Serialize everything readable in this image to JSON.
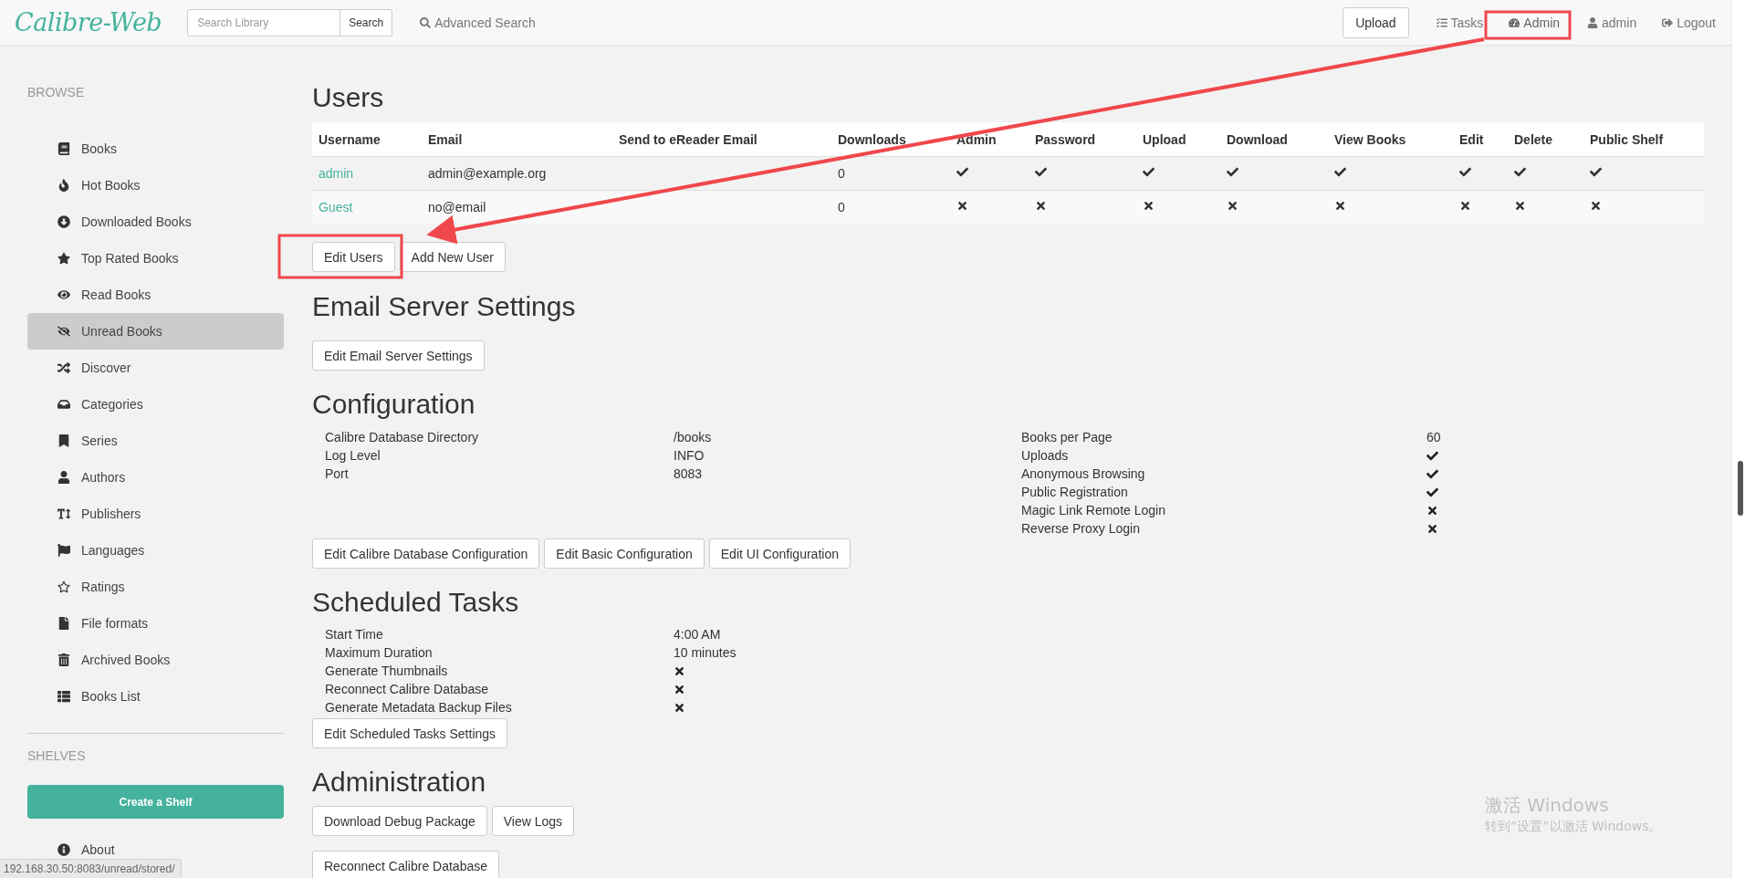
{
  "navbar": {
    "logo": "Calibre-Web",
    "search": {
      "placeholder": "Search Library",
      "button": "Search"
    },
    "advanced_search": "Advanced Search",
    "upload": "Upload",
    "links": [
      {
        "label": "Tasks",
        "kind": "tasks",
        "selected": false
      },
      {
        "label": "Admin",
        "kind": "admin",
        "selected": true
      },
      {
        "label": "admin",
        "kind": "user",
        "selected": false
      },
      {
        "label": "Logout",
        "kind": "logout",
        "selected": false
      }
    ]
  },
  "sidebar": {
    "browse_heading": "BROWSE",
    "items": [
      {
        "label": "Books",
        "kind": "books",
        "selected": false
      },
      {
        "label": "Hot Books",
        "kind": "hot",
        "selected": false
      },
      {
        "label": "Downloaded Books",
        "kind": "downloaded",
        "selected": false
      },
      {
        "label": "Top Rated Books",
        "kind": "top",
        "selected": false
      },
      {
        "label": "Read Books",
        "kind": "read",
        "selected": false
      },
      {
        "label": "Unread Books",
        "kind": "unread",
        "selected": true
      },
      {
        "label": "Discover",
        "kind": "discover",
        "selected": false
      },
      {
        "label": "Categories",
        "kind": "categories",
        "selected": false
      },
      {
        "label": "Series",
        "kind": "series",
        "selected": false
      },
      {
        "label": "Authors",
        "kind": "authors",
        "selected": false
      },
      {
        "label": "Publishers",
        "kind": "publishers",
        "selected": false
      },
      {
        "label": "Languages",
        "kind": "languages",
        "selected": false
      },
      {
        "label": "Ratings",
        "kind": "ratings",
        "selected": false
      },
      {
        "label": "File formats",
        "kind": "formats",
        "selected": false
      },
      {
        "label": "Archived Books",
        "kind": "archived",
        "selected": false
      },
      {
        "label": "Books List",
        "kind": "list",
        "selected": false
      }
    ],
    "shelves_heading": "SHELVES",
    "create_shelf": "Create a Shelf",
    "about": "About"
  },
  "users": {
    "title": "Users",
    "columns": [
      "Username",
      "Email",
      "Send to eReader Email",
      "Downloads",
      "Admin",
      "Password",
      "Upload",
      "Download",
      "View Books",
      "Edit",
      "Delete",
      "Public Shelf"
    ],
    "rows": [
      {
        "username": "admin",
        "email": "admin@example.org",
        "downloads": "0",
        "permissions": [
          true,
          true,
          true,
          true,
          true,
          true,
          true,
          true
        ]
      },
      {
        "username": "Guest",
        "email": "no@email",
        "downloads": "0",
        "permissions": [
          false,
          false,
          false,
          false,
          false,
          false,
          false,
          false
        ]
      }
    ],
    "buttons": [
      "Edit Users",
      "Add New User"
    ]
  },
  "email_server": {
    "title": "Email Server Settings",
    "buttons": [
      "Edit Email Server Settings"
    ]
  },
  "configuration": {
    "title": "Configuration",
    "left": [
      {
        "label": "Calibre Database Directory",
        "kind": "text",
        "value": "/books"
      },
      {
        "label": "Log Level",
        "kind": "text",
        "value": "INFO"
      },
      {
        "label": "Port",
        "kind": "text",
        "value": "8083"
      }
    ],
    "right": [
      {
        "label": "Books per Page",
        "kind": "text",
        "value": "60"
      },
      {
        "label": "Uploads",
        "kind": "flag",
        "enabled": true
      },
      {
        "label": "Anonymous Browsing",
        "kind": "flag",
        "enabled": true
      },
      {
        "label": "Public Registration",
        "kind": "flag",
        "enabled": true
      },
      {
        "label": "Magic Link Remote Login",
        "kind": "flag",
        "enabled": false
      },
      {
        "label": "Reverse Proxy Login",
        "kind": "flag",
        "enabled": false
      }
    ],
    "buttons": [
      "Edit Calibre Database Configuration",
      "Edit Basic Configuration",
      "Edit UI Configuration"
    ]
  },
  "scheduled_tasks": {
    "title": "Scheduled Tasks",
    "rows": [
      {
        "label": "Start Time",
        "kind": "text",
        "value": "4:00 AM"
      },
      {
        "label": "Maximum Duration",
        "kind": "text",
        "value": "10 minutes"
      },
      {
        "label": "Generate Thumbnails",
        "kind": "flag",
        "enabled": false
      },
      {
        "label": "Reconnect Calibre Database",
        "kind": "flag",
        "enabled": false
      },
      {
        "label": "Generate Metadata Backup Files",
        "kind": "flag",
        "enabled": false
      }
    ],
    "buttons": [
      "Edit Scheduled Tasks Settings"
    ]
  },
  "administration": {
    "title": "Administration",
    "buttons": [
      "Download Debug Package",
      "View Logs"
    ],
    "second_buttons": [
      "Reconnect Calibre Database"
    ]
  },
  "status_url": "192.168.30.50:8083/unread/stored/",
  "activation_notice": {
    "title": "激活 Windows",
    "text": "转到“设置”以激活 Windows。"
  }
}
